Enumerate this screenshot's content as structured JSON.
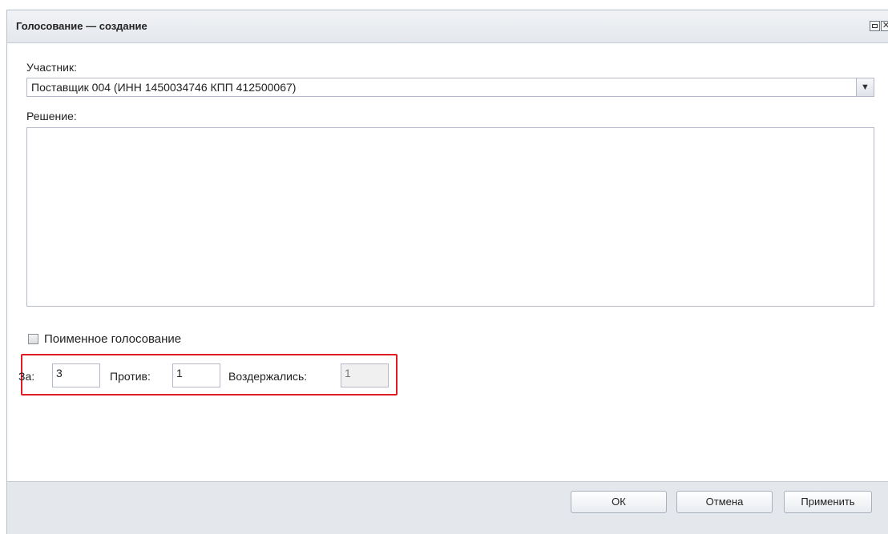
{
  "dialog": {
    "title": "Голосование — создание",
    "maximize_icon": "maximize-icon",
    "close_icon": "close-icon"
  },
  "form": {
    "participant_label": "Участник:",
    "participant_value": "Поставщик 004 (ИНН 1450034746 КПП 412500067)",
    "decision_label": "Решение:",
    "decision_value": "",
    "nominal_voting_label": "Поименное голосование",
    "nominal_voting_checked": false,
    "for_label": "За:",
    "for_value": "3",
    "against_label": "Против:",
    "against_value": "1",
    "abstained_label": "Воздержались:",
    "abstained_value": "1"
  },
  "buttons": {
    "ok": "ОК",
    "cancel": "Отмена",
    "apply": "Применить"
  },
  "colors": {
    "highlight_border": "#e21c27",
    "dialog_bg": "#e4e7ec"
  }
}
